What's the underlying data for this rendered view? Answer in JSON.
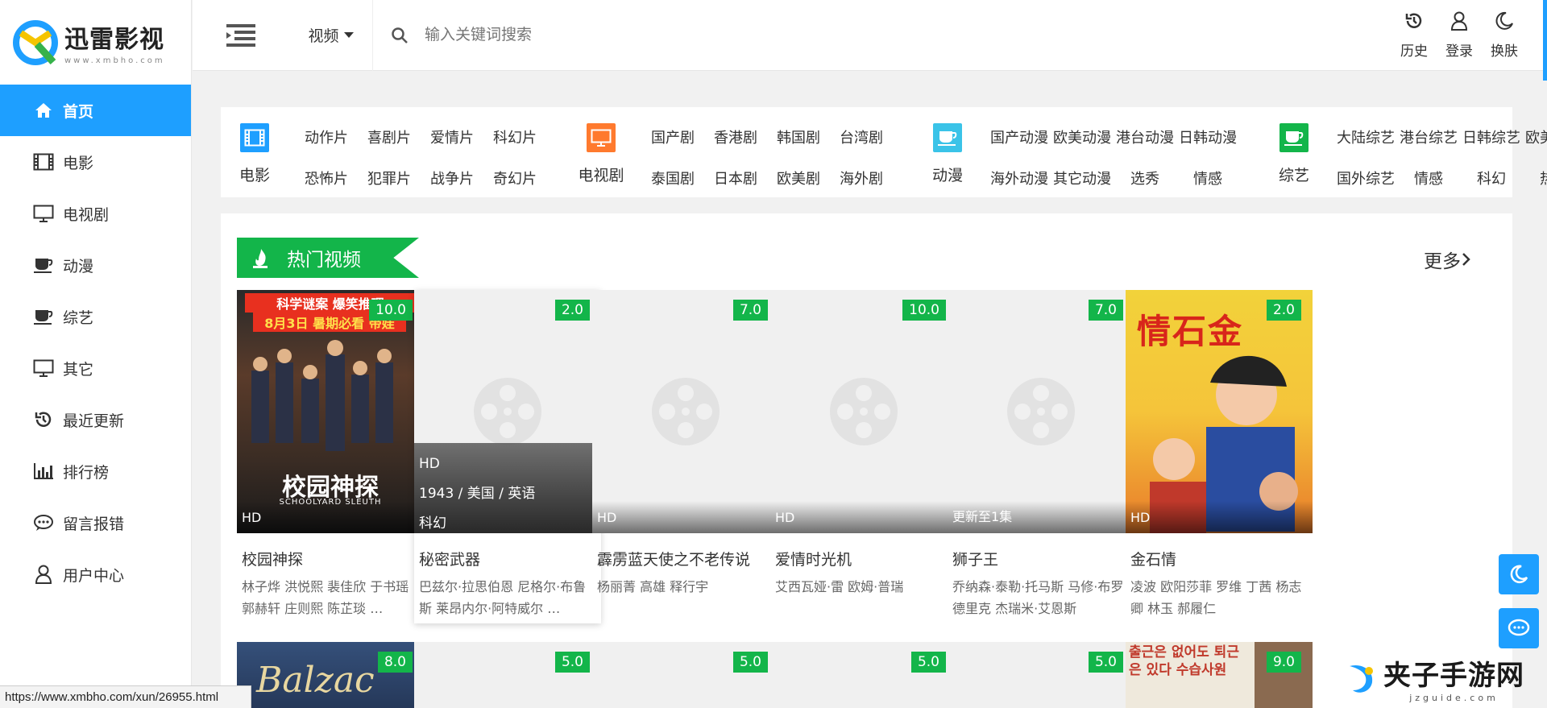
{
  "logo": {
    "title": "迅雷影视",
    "subtitle": "www.xmbho.com"
  },
  "sidebar": {
    "items": [
      {
        "label": "首页",
        "icon": "home-icon"
      },
      {
        "label": "电影",
        "icon": "film-icon"
      },
      {
        "label": "电视剧",
        "icon": "tv-icon"
      },
      {
        "label": "动漫",
        "icon": "cup-icon"
      },
      {
        "label": "综艺",
        "icon": "cup-icon"
      },
      {
        "label": "其它",
        "icon": "monitor-icon"
      },
      {
        "label": "最近更新",
        "icon": "history-icon"
      },
      {
        "label": "排行榜",
        "icon": "bar-chart-icon"
      },
      {
        "label": "留言报错",
        "icon": "comment-icon"
      },
      {
        "label": "用户中心",
        "icon": "user-icon"
      }
    ]
  },
  "header": {
    "category": "视频",
    "search_placeholder": "输入关键词搜索",
    "actions": [
      {
        "label": "历史",
        "icon": "history-icon"
      },
      {
        "label": "登录",
        "icon": "user-icon"
      },
      {
        "label": "换肤",
        "icon": "moon-icon"
      }
    ]
  },
  "categories": [
    {
      "name": "电影",
      "color": "#1e9fff",
      "links": [
        "动作片",
        "喜剧片",
        "爱情片",
        "科幻片",
        "恐怖片",
        "犯罪片",
        "战争片",
        "奇幻片"
      ]
    },
    {
      "name": "电视剧",
      "color": "#ff7a2e",
      "links": [
        "国产剧",
        "香港剧",
        "韩国剧",
        "台湾剧",
        "泰国剧",
        "日本剧",
        "欧美剧",
        "海外剧"
      ]
    },
    {
      "name": "动漫",
      "color": "#3ac3e8",
      "links": [
        "国产动漫",
        "欧美动漫",
        "港台动漫",
        "日韩动漫",
        "海外动漫",
        "其它动漫",
        "选秀",
        "情感"
      ]
    },
    {
      "name": "综艺",
      "color": "#13b54a",
      "links": [
        "大陆综艺",
        "港台综艺",
        "日韩综艺",
        "欧美综艺",
        "国外综艺",
        "情感",
        "科幻",
        "热血"
      ]
    }
  ],
  "hot": {
    "title": "热门视频",
    "more": "更多",
    "cards": [
      {
        "score": "10.0",
        "badge": "HD",
        "title": "校园神探",
        "cast": "林子烨 洪悦熙 裴佳欣 于书瑶 郭赫轩 庄则熙 陈芷琰 …",
        "poster_title": "校园神探",
        "poster_sub": "SCHOOLYARD SLEUTH",
        "poster_banner1": "科学谜案 爆笑推理",
        "poster_banner2": "8月3日 暑期必看 带娃"
      },
      {
        "score": "2.0",
        "badge": "HD",
        "title": "秘密武器",
        "cast": "巴兹尔·拉思伯恩 尼格尔·布鲁斯 莱昂内尔·阿特威尔 …",
        "info": "1943 / 美国 / 英语",
        "genre": "科幻"
      },
      {
        "score": "7.0",
        "badge": "HD",
        "title": "霹雳蓝天使之不老传说",
        "cast": "杨丽菁 高雄 释行宇"
      },
      {
        "score": "10.0",
        "badge": "HD",
        "title": "爱情时光机",
        "cast": "艾西瓦娅·雷 欧姆·普瑞"
      },
      {
        "score": "7.0",
        "badge": "更新至1集",
        "title": "狮子王",
        "cast": "乔纳森·泰勒·托马斯 马修·布罗德里克 杰瑞米·艾恩斯"
      },
      {
        "score": "2.0",
        "badge": "HD",
        "title": "金石情",
        "cast": "凌波 欧阳莎菲 罗维 丁茜 杨志卿 林玉 郝履仁",
        "poster_title": "情石金"
      }
    ],
    "row2_scores": [
      "8.0",
      "5.0",
      "5.0",
      "5.0",
      "5.0",
      "9.0"
    ],
    "row2_poster1": "Balzac",
    "row2_poster6": "출근은 없어도 퇴근은 있다 수습사원"
  },
  "statusbar": "https://www.xmbho.com/xun/26955.html",
  "watermark": {
    "title": "夹子手游网",
    "sub": "jzguide.com"
  }
}
